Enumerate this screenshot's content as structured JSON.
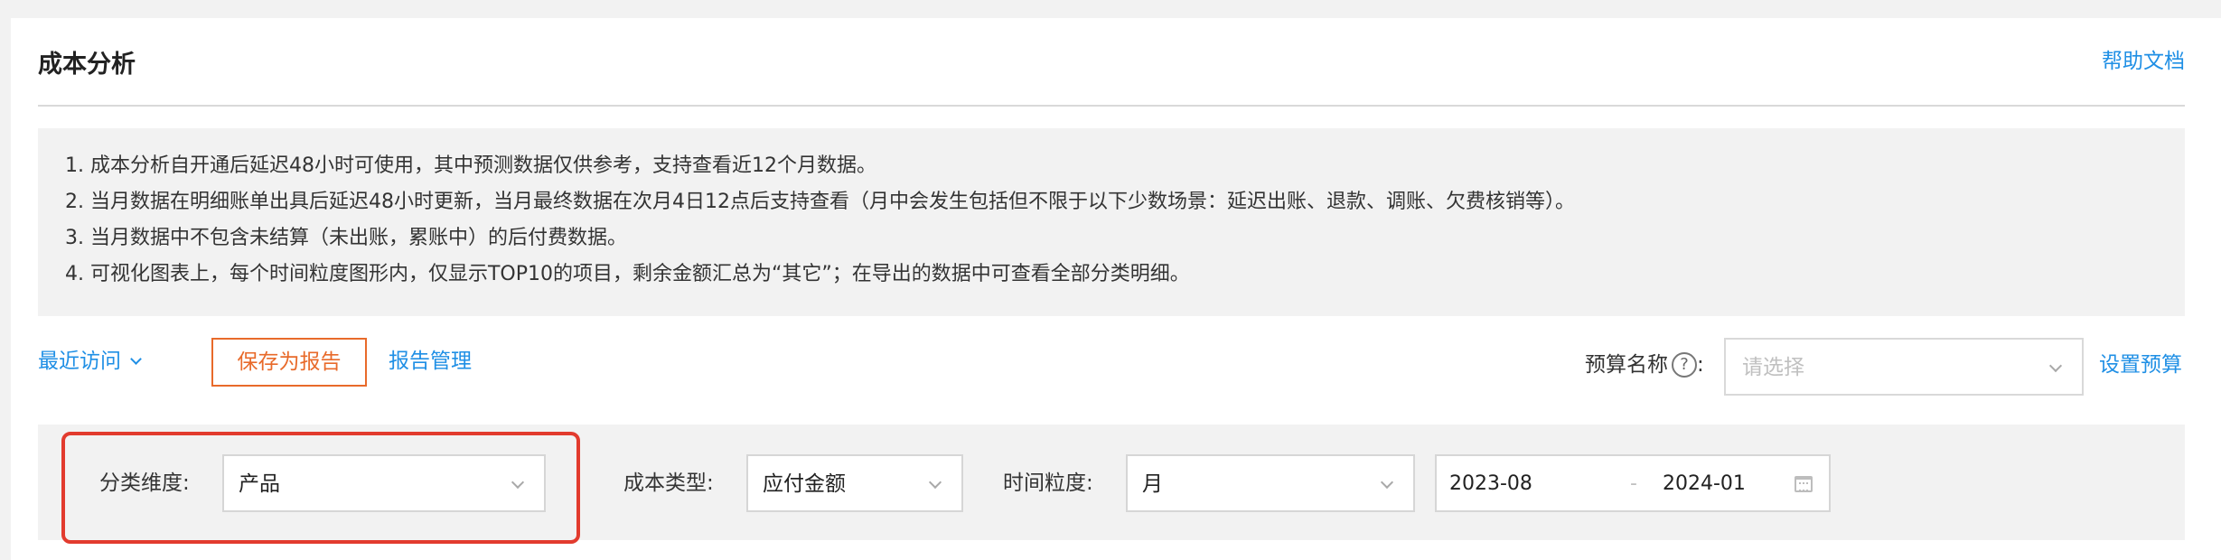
{
  "header": {
    "title": "成本分析",
    "help_link": "帮助文档"
  },
  "notice": {
    "lines": [
      "1. 成本分析自开通后延迟48小时可使用，其中预测数据仅供参考，支持查看近12个月数据。",
      "2. 当月数据在明细账单出具后延迟48小时更新，当月最终数据在次月4日12点后支持查看（月中会发生包括但不限于以下少数场景：延迟出账、退款、调账、欠费核销等）。",
      "3. 当月数据中不包含未结算（未出账，累账中）的后付费数据。",
      "4. 可视化图表上，每个时间粒度图形内，仅显示TOP10的项目，剩余金额汇总为“其它”；在导出的数据中可查看全部分类明细。"
    ]
  },
  "toolbar": {
    "recent_visit": "最近访问",
    "save_report": "保存为报告",
    "report_manage": "报告管理",
    "budget_label": "预算名称",
    "budget_help": "?",
    "budget_colon": ":",
    "budget_placeholder": "请选择",
    "set_budget": "设置预算"
  },
  "filters": {
    "dimension_label": "分类维度:",
    "dimension_value": "产品",
    "cost_type_label": "成本类型:",
    "cost_type_value": "应付金额",
    "granularity_label": "时间粒度:",
    "granularity_value": "月",
    "date_start": "2023-08",
    "date_sep": "-",
    "date_end": "2024-01"
  },
  "colors": {
    "link": "#1f8fe5",
    "save_button": "#e86a2a",
    "highlight": "#e23b2e"
  }
}
